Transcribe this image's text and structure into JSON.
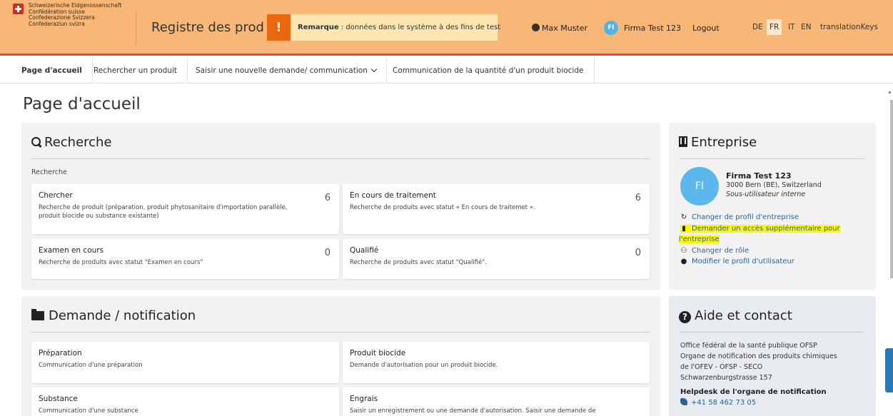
{
  "header": {
    "confederation_lines": [
      "Schweizerische Eidgenossenschaft",
      "Confédération suisse",
      "Confederazione Svizzera",
      "Confederaziun svizra"
    ],
    "app_title": "Registre des prod",
    "alert_icon": "!",
    "remark_label": "Remarque",
    "remark_text": " : données dans le système à des fins de test",
    "user_name": "Max Muster",
    "firm_initials": "FI",
    "firm_name": "Firma Test 123",
    "logout": "Logout",
    "languages": [
      "DE",
      "FR",
      "IT",
      "EN",
      "translationKeys"
    ],
    "active_language": "FR",
    "accent_color": "#f8b777",
    "border_color": "#e2454b"
  },
  "nav": {
    "tabs": [
      {
        "label": "Page d'accueil",
        "active": true
      },
      {
        "label": "Rechercher un produit",
        "active": false
      },
      {
        "label": "Saisir une nouvelle demande/ communication",
        "active": false,
        "dropdown": true
      },
      {
        "label": "Communication de la quantité d'un produit biocide",
        "active": false
      }
    ]
  },
  "page_title": "Page d'accueil",
  "search": {
    "title": "Recherche",
    "icon": "search-icon",
    "sub_label": "Recherche",
    "cards": [
      {
        "title": "Chercher",
        "desc": "Recherche de produit (préparation, produit phytosanitaire d'importation parallèle, produit biocide ou substance existante)",
        "count": "6"
      },
      {
        "title": "En cours de traitement",
        "desc": "Recherche de produits avec statut « En cours de traitemet ».",
        "count": "6"
      },
      {
        "title": "Examen en cours",
        "desc": "Recherche de produits avec statut \"Examen en cours\"",
        "count": "0"
      },
      {
        "title": "Qualifié",
        "desc": "Recherche de produits avec statut \"Qualifié\".",
        "count": "0"
      }
    ]
  },
  "request": {
    "title": "Demande / notification",
    "icon": "folder-icon",
    "cards": [
      {
        "title": "Préparation",
        "desc": "Communication d'une préparation"
      },
      {
        "title": "Produit biocide",
        "desc": "Demande d'autorisation pour un produit biocide."
      },
      {
        "title": "Substance",
        "desc": "Communication d'une substance"
      },
      {
        "title": "Engrais",
        "desc": "Saisir un enregistrement ou une demande d'autorisation. Saisir une demande de"
      }
    ]
  },
  "company": {
    "title": "Entreprise",
    "icon": "building-icon",
    "initials": "FI",
    "name": "Firma Test 123",
    "address": "3000 Bern (BE), Switzerland",
    "role": "Sous-utilisateur interne",
    "links": [
      {
        "label": "Changer de profil d'entreprise",
        "icon": "refresh-icon"
      },
      {
        "label": "Demander un accès supplémentaire pour",
        "label2": "l'entreprise",
        "icon": "building-icon",
        "highlight": true
      },
      {
        "label": "Changer de rôle",
        "icon": "users-icon"
      },
      {
        "label": "Modifier le profil d'utilisateur",
        "icon": "user-icon"
      }
    ]
  },
  "help": {
    "title": "Aide et contact",
    "icon": "help-icon",
    "lines": [
      "Office fédéral de la santé publique OFSP",
      "Organe de notification des produits chimiques",
      "de l'OFEV - OFSP - SECO",
      "Schwarzenburgstrasse 157"
    ],
    "helpdesk_label": "Helpdesk de l'organe de notification",
    "phone": "+41 58 462 73 05"
  }
}
